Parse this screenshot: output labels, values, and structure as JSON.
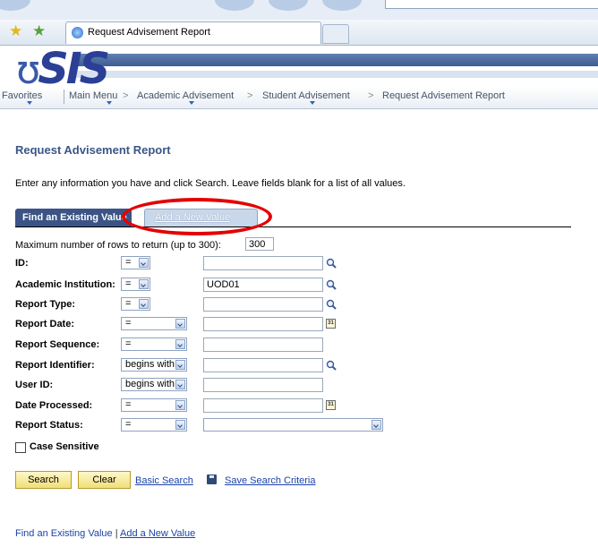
{
  "browser": {
    "tab_title": "Request Advisement Report"
  },
  "logo_text": "SIS",
  "breadcrumb": {
    "favorites": "Favorites",
    "main_menu": "Main Menu",
    "academic_advisement": "Academic Advisement",
    "student_advisement": "Student Advisement",
    "current": "Request Advisement Report",
    "separator": ">"
  },
  "page": {
    "title": "Request Advisement Report",
    "instructions": "Enter any information you have and click Search. Leave fields blank for a list of all values."
  },
  "tabs": {
    "find_existing": "Find an Existing Value",
    "add_new": "Add a New Value"
  },
  "max_rows": {
    "label": "Maximum number of rows to return (up to 300):",
    "value": "300"
  },
  "fields": [
    {
      "label": "ID:",
      "operator": "=",
      "value": "",
      "lookup": "magnifier"
    },
    {
      "label": "Academic Institution:",
      "operator": "=",
      "value": "UOD01",
      "lookup": "magnifier"
    },
    {
      "label": "Report Type:",
      "operator": "=",
      "value": "",
      "lookup": "magnifier"
    },
    {
      "label": "Report Date:",
      "operator": "=",
      "value": "",
      "lookup": "calendar"
    },
    {
      "label": "Report Sequence:",
      "operator": "=",
      "value": "",
      "lookup": ""
    },
    {
      "label": "Report Identifier:",
      "operator": "begins with",
      "value": "",
      "lookup": "magnifier"
    },
    {
      "label": "User ID:",
      "operator": "begins with",
      "value": "",
      "lookup": ""
    },
    {
      "label": "Date Processed:",
      "operator": "=",
      "value": "",
      "lookup": "calendar"
    },
    {
      "label": "Report Status:",
      "operator": "=",
      "value": "",
      "lookup": "dropdown"
    }
  ],
  "calendar_icon_text": "31",
  "case_sensitive": {
    "label": "Case Sensitive",
    "checked": false
  },
  "buttons": {
    "search": "Search",
    "clear": "Clear",
    "basic_search": "Basic Search",
    "save_search": "Save Search Criteria"
  },
  "footer": {
    "find_existing": "Find an Existing Value",
    "separator": "|",
    "add_new": "Add a New Value"
  },
  "colors": {
    "active_tab": "#3c5485",
    "title_color": "#3b5688",
    "link_color": "#1b43a8",
    "button_fill": "#f0df7a",
    "highlight_ring": "#e40000"
  }
}
